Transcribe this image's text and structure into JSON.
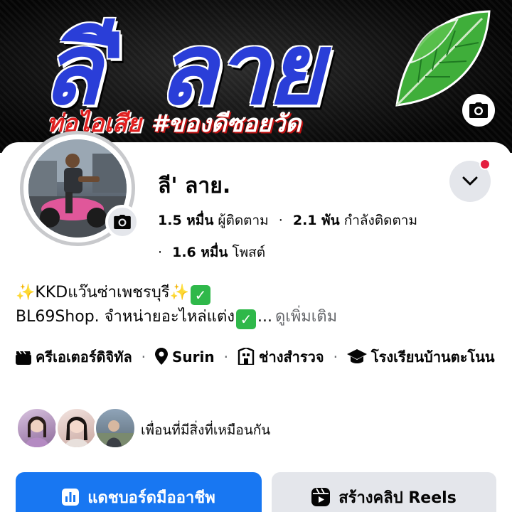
{
  "cover": {
    "title": "ลี' ลาย",
    "subtitle_left": "ท่อไอเสีย",
    "subtitle_right": "#ของดีซอยวัด"
  },
  "profile": {
    "name": "ลี' ลาย."
  },
  "stats": {
    "followers_value": "1.5 หมื่น",
    "followers_label": "ผู้ติดตาม",
    "following_value": "2.1 พัน",
    "following_label": "กำลังติดตาม",
    "posts_value": "1.6 หมื่น",
    "posts_label": "โพสต์",
    "separator": "·"
  },
  "bio": {
    "line1_text": "KKDแว๊นซ่าเพชรบุรี",
    "line2_text": "BL69Shop. จำหน่ายอะไหล่แต่ง",
    "ellipsis": "...",
    "see_more": "ดูเพิ่มเติม"
  },
  "details": {
    "creator": "ครีเอเตอร์ดิจิทัล",
    "location": "Surin",
    "job": "ช่างสำรวจ",
    "school": "โรงเรียนบ้านตะโนน",
    "separator": "·"
  },
  "mutual": {
    "text": "เพื่อนที่มีสิ่งที่เหมือนกัน"
  },
  "buttons": {
    "dashboard": "แดชบอร์ดมืออาชีพ",
    "reels": "สร้างคลิป Reels"
  },
  "colors": {
    "primary": "#1877f2",
    "secondary_button": "#e4e6eb",
    "notification_dot": "#e41e3f",
    "cover_blue": "#2a3ed8"
  },
  "icons": {
    "cover_camera": "camera-icon",
    "avatar_camera": "camera-icon",
    "chevron": "chevron-down-icon",
    "creator": "clapperboard-icon",
    "location": "map-pin-icon",
    "job": "briefcase-icon",
    "school": "graduation-cap-icon",
    "dashboard": "bar-chart-icon",
    "reels": "reels-icon"
  }
}
